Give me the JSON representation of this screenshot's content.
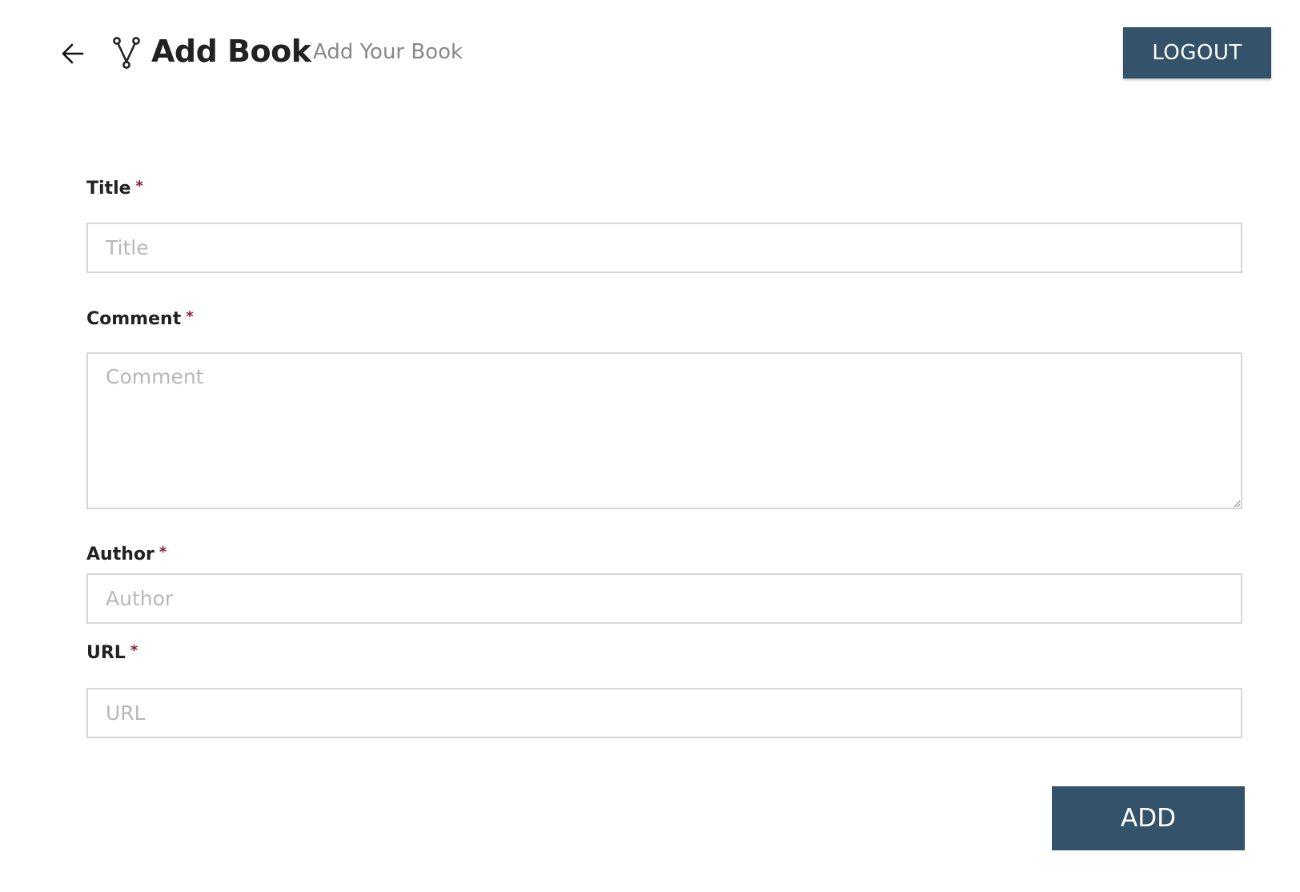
{
  "header": {
    "back_icon": "arrow-left-icon",
    "logo_icon": "fork-logo-icon",
    "title": "Add Book",
    "subtitle": "Add Your Book",
    "logout_label": "LOGOUT"
  },
  "form": {
    "required_mark": "*",
    "fields": [
      {
        "label": "Title",
        "placeholder": "Title",
        "value": ""
      },
      {
        "label": "Comment",
        "placeholder": "Comment",
        "value": ""
      },
      {
        "label": "Author",
        "placeholder": "Author",
        "value": ""
      },
      {
        "label": "URL",
        "placeholder": "URL",
        "value": ""
      }
    ],
    "submit_label": "ADD"
  },
  "colors": {
    "button_bg": "#34536a",
    "required_mark": "#8b1c2b",
    "input_border": "#d6d6d6",
    "placeholder": "#b8b8b8"
  }
}
